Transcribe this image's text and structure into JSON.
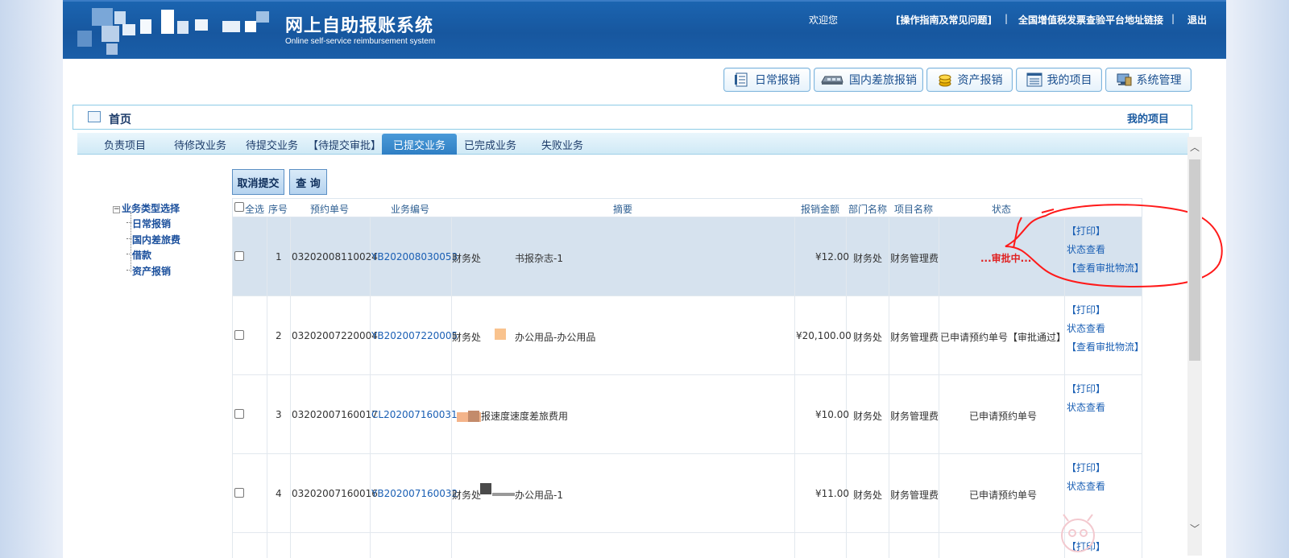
{
  "header": {
    "title": "网上自助报账系统",
    "subtitle": "Online self-service reimbursement system",
    "welcome": "欢迎您",
    "links": [
      "[操作指南及常见问题]",
      "|",
      "全国增值税发票查验平台地址链接",
      "|",
      "退出"
    ]
  },
  "modules": [
    {
      "label": "日常报销",
      "icon": "notebook-icon"
    },
    {
      "label": "国内差旅报销",
      "icon": "train-icon"
    },
    {
      "label": "资产报销",
      "icon": "coins-icon"
    },
    {
      "label": "我的项目",
      "icon": "list-window-icon"
    },
    {
      "label": "系统管理",
      "icon": "computer-icon"
    }
  ],
  "breadcrumb": {
    "home": "首页",
    "right": "我的项目"
  },
  "tabs": [
    "负责项目",
    "待修改业务",
    "待提交业务",
    "【待提交审批】",
    "已提交业务",
    "已完成业务",
    "失败业务"
  ],
  "active_tab": "已提交业务",
  "tree": {
    "root": "业务类型选择",
    "items": [
      "日常报销",
      "国内差旅费",
      "借款",
      "资产报销"
    ]
  },
  "actions": {
    "cancel_submit": "取消提交",
    "query": "查 询"
  },
  "table": {
    "headers": {
      "select_all": "全选",
      "seq": "序号",
      "appt_no": "预约单号",
      "biz_no": "业务编号",
      "summary": "摘要",
      "amount": "报销金额",
      "dept": "部门名称",
      "project": "项目名称",
      "status": "状态"
    },
    "rows": [
      {
        "seq": "1",
        "appt_no": "03202008110024",
        "biz_no": "YB202008030053",
        "summary_a": "财务处",
        "summary_b": "书报杂志-1",
        "amount": "¥12.00",
        "dept": "财务处",
        "project": "财务管理费",
        "status": "...审批中...",
        "ops": [
          "【打印】",
          "状态查看",
          "【查看审批物流】"
        ]
      },
      {
        "seq": "2",
        "appt_no": "03202007220004",
        "biz_no": "YB202007220005",
        "summary_a": "财务处",
        "summary_b": "办公用品-办公用品",
        "amount": "¥20,100.00",
        "dept": "财务处",
        "project": "财务管理费",
        "status": "已申请预约单号【审批通过】",
        "ops": [
          "【打印】",
          "状态查看",
          "【查看审批物流】"
        ]
      },
      {
        "seq": "3",
        "appt_no": "03202007160017",
        "biz_no": "CL202007160031",
        "summary_a": "",
        "summary_b": "报速度速度差旅费用",
        "amount": "¥10.00",
        "dept": "财务处",
        "project": "财务管理费",
        "status": "已申请预约单号",
        "ops": [
          "【打印】",
          "状态查看"
        ]
      },
      {
        "seq": "4",
        "appt_no": "03202007160016",
        "biz_no": "YB202007160032",
        "summary_a": "财务处",
        "summary_b": "办公用品-1",
        "amount": "¥11.00",
        "dept": "财务处",
        "project": "财务管理费",
        "status": "已申请预约单号",
        "ops": [
          "【打印】",
          "状态查看"
        ]
      },
      {
        "seq": "",
        "appt_no": "",
        "biz_no": "",
        "summary_a": "",
        "summary_b": "",
        "amount": "",
        "dept": "",
        "project": "",
        "status": "",
        "ops": [
          "【打印】"
        ]
      }
    ]
  },
  "colors": {
    "header_blue": "#1b64b0",
    "link_blue": "#1a5fb4",
    "status_red": "#e02020",
    "selected_row": "#d6e2ee"
  }
}
